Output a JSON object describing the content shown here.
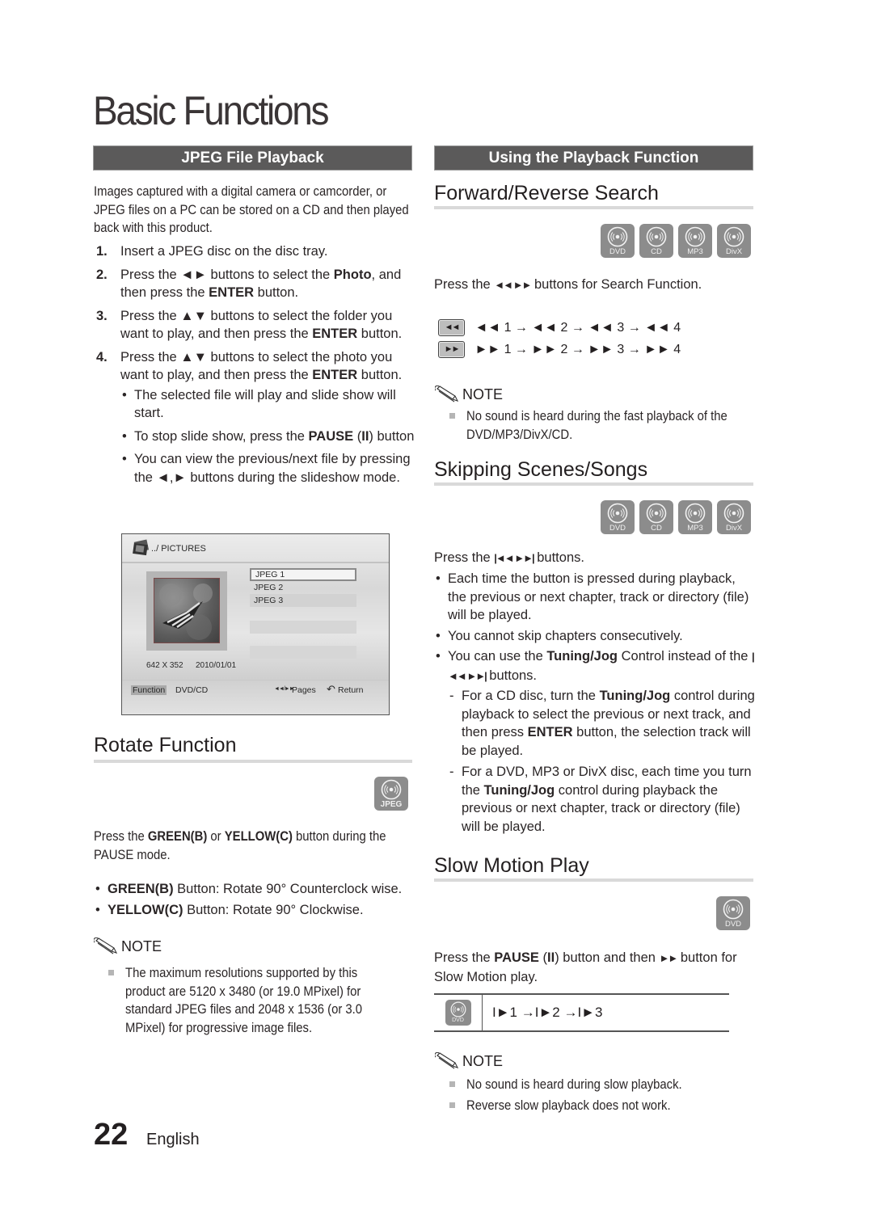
{
  "page": {
    "title": "Basic Functions",
    "page_number": "22",
    "language": "English"
  },
  "left": {
    "section_title": "JPEG File Playback",
    "intro": "Images captured with a digital camera or camcorder, or JPEG files on a PC can be stored on a CD and then played back with this product.",
    "steps": [
      {
        "num": "1.",
        "pre": "Insert a JPEG disc on the disc tray."
      },
      {
        "num": "2.",
        "pre": "Press the ◄► buttons to select the ",
        "b1": "Photo",
        "mid": ", and then press the ",
        "b2": "ENTER",
        "post": " button."
      },
      {
        "num": "3.",
        "pre": "Press the ▲▼ buttons to select the folder you want to play, and then press the ",
        "b1": "ENTER",
        "post": " button."
      },
      {
        "num": "4.",
        "pre": "Press the ▲▼ buttons to select the photo you want to play, and then press the ",
        "b1": "ENTER",
        "post": " button."
      }
    ],
    "step4_bullets": [
      {
        "pre": "The selected file will play and slide show will start."
      },
      {
        "pre": "To stop slide show, press the ",
        "b1": "PAUSE",
        "mid": " (",
        "b2": "II",
        "post": ") button"
      },
      {
        "pre": "You can view the previous/next file by pressing the ◄,► buttons during the slideshow mode."
      }
    ],
    "screen": {
      "path": "../ PICTURES",
      "files": [
        "JPEG 1",
        "JPEG 2",
        "JPEG 3"
      ],
      "selected_file": "JPEG 1",
      "resolution": "642 X 352",
      "date": "2010/01/01",
      "function_label": "Function",
      "source_label": "DVD/CD",
      "pages_icon": "◄◄/►►",
      "pages_label": "Pages",
      "return_icon": "↶",
      "return_label": "Return"
    },
    "rotate": {
      "heading": "Rotate Function",
      "badge": "JPEG",
      "intro_pre": "Press the ",
      "intro_b1": "GREEN(B)",
      "intro_mid": " or ",
      "intro_b2": "YELLOW(C)",
      "intro_post": " button during the PAUSE mode.",
      "bullets": [
        {
          "b": "GREEN(B)",
          "text": " Button: Rotate 90° Counterclock wise."
        },
        {
          "b": "YELLOW(C)",
          "text": " Button: Rotate 90° Clockwise."
        }
      ],
      "note_label": "NOTE",
      "notes": [
        "The maximum resolutions supported by this product are 5120 x 3480 (or 19.0 MPixel) for standard JPEG files and 2048 x 1536 (or 3.0 MPixel) for progressive image files."
      ]
    }
  },
  "right": {
    "section_title": "Using the Playback Function",
    "search": {
      "heading": "Forward/Reverse Search",
      "badges": [
        "DVD",
        "CD",
        "MP3",
        "DivX"
      ],
      "instruction_pre": "Press the ",
      "instruction_icons": "◄◄ ►►",
      "instruction_post": " buttons for Search Function.",
      "rows": [
        {
          "key": "◄◄",
          "sequence": "◄◄ 1 → ◄◄ 2 → ◄◄ 3 → ◄◄ 4"
        },
        {
          "key": "►►",
          "sequence": "►► 1 → ►► 2 → ►► 3 → ►► 4"
        }
      ],
      "note_label": "NOTE",
      "notes": [
        "No sound is heard during the fast playback of the DVD/MP3/DivX/CD."
      ]
    },
    "skip": {
      "heading": "Skipping Scenes/Songs",
      "badges": [
        "DVD",
        "CD",
        "MP3",
        "DivX"
      ],
      "instruction_pre": "Press the ",
      "instruction_icons": "|◄◄ ►►|",
      "instruction_post": " buttons.",
      "bullets": [
        {
          "pre": "Each time the button is pressed during playback, the previous or next chapter, track or directory (file) will be played."
        },
        {
          "pre": "You cannot skip chapters consecutively."
        },
        {
          "pre": "You can use the ",
          "b1": "Tuning/Jog",
          "mid": " Control instead of the ",
          "icons": "|◄◄ ►►|",
          "post": " buttons."
        }
      ],
      "dashes": [
        {
          "pre": "For a CD disc, turn the ",
          "b1": "Tuning/Jog",
          "mid": " control during playback to select the previous or next track, and then press ",
          "b2": "ENTER",
          "post": " button, the selection track will be played."
        },
        {
          "pre": "For a DVD, MP3 or DivX disc, each time you turn the ",
          "b1": "Tuning/Jog",
          "post": " control during playback the previous or next chapter, track or directory (file) will be played."
        }
      ]
    },
    "slow": {
      "heading": "Slow Motion Play",
      "badge": "DVD",
      "instruction_pre": "Press the ",
      "instruction_b1": "PAUSE",
      "instruction_mid": " (",
      "instruction_b2": "II",
      "instruction_mid2": ") button and then ",
      "instruction_icon": "►►",
      "instruction_post": " button for Slow Motion play.",
      "table_badge": "DVD",
      "sequence": "I►1 →I►2 →I►3",
      "note_label": "NOTE",
      "notes": [
        "No sound is heard during slow playback.",
        "Reverse slow playback does not work."
      ]
    }
  }
}
